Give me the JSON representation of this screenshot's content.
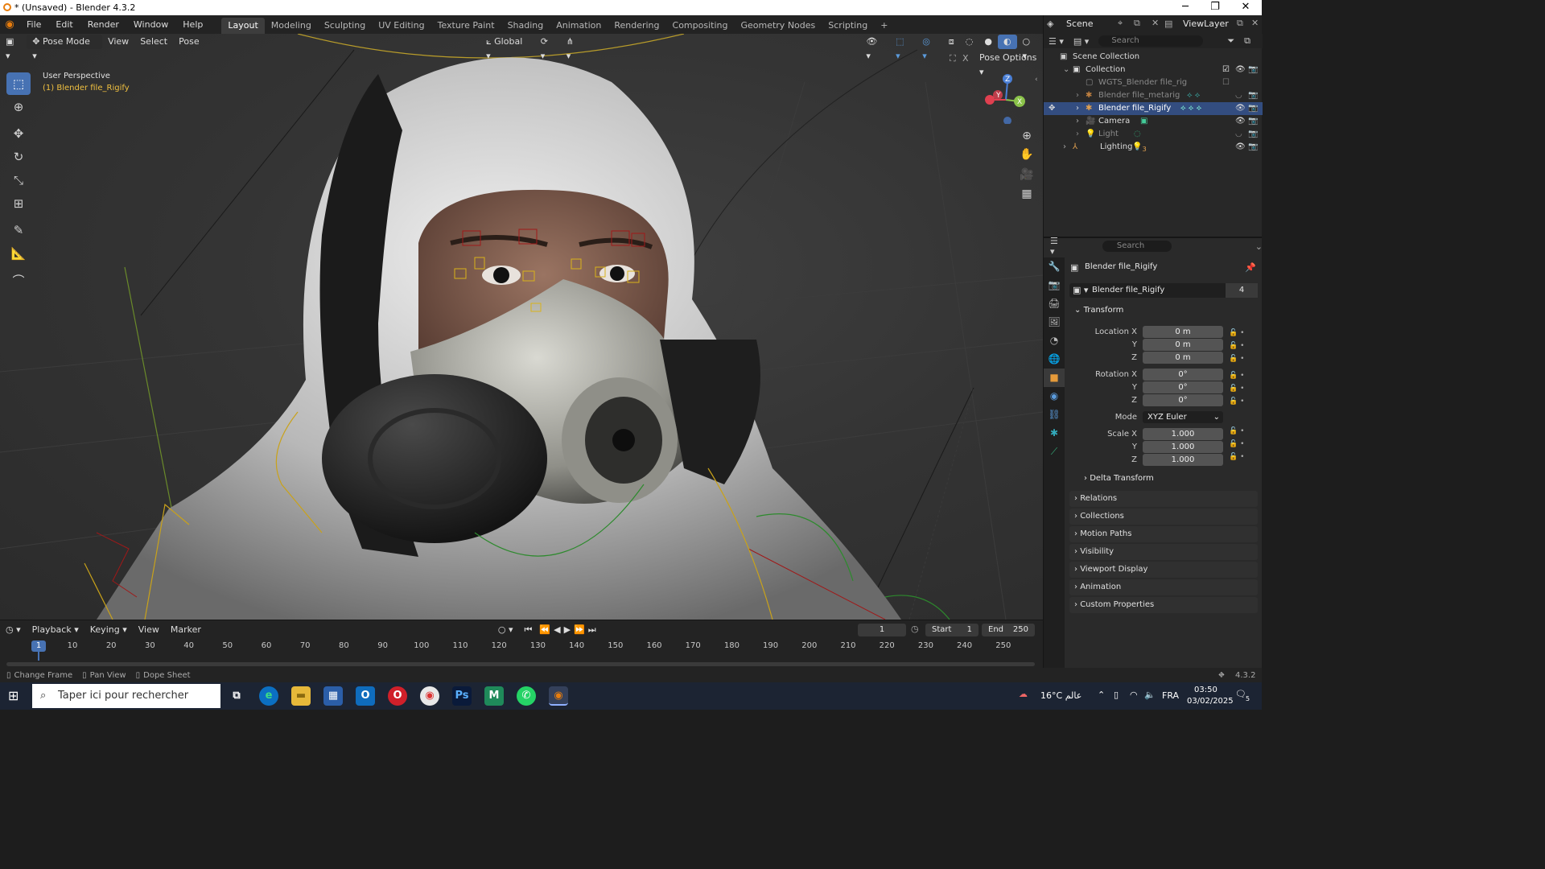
{
  "window": {
    "title": "* (Unsaved) - Blender 4.3.2",
    "controls": [
      "─",
      "❐",
      "✕"
    ]
  },
  "topmenu": {
    "menus": [
      "File",
      "Edit",
      "Render",
      "Window",
      "Help"
    ],
    "workspaces": [
      "Layout",
      "Modeling",
      "Sculpting",
      "UV Editing",
      "Texture Paint",
      "Shading",
      "Animation",
      "Rendering",
      "Compositing",
      "Geometry Nodes",
      "Scripting"
    ],
    "active_workspace": "Layout",
    "add_tab": "+"
  },
  "scenebar": {
    "scene": "Scene",
    "view_layer": "ViewLayer"
  },
  "viewport": {
    "mode": "Pose Mode",
    "menus": [
      "View",
      "Select",
      "Pose"
    ],
    "orientation": "Global",
    "options": "Pose Options",
    "perspective_label": "User Perspective",
    "object_label": "(1) Blender file_Rigify",
    "gizmo": {
      "x": "X",
      "y": "Y",
      "z": "Z"
    }
  },
  "outliner": {
    "search_placeholder": "Search",
    "scene_collection": "Scene Collection",
    "items": [
      {
        "label": "Collection"
      },
      {
        "label": "WGTS_Blender file_rig"
      },
      {
        "label": "Blender file_metarig"
      },
      {
        "label": "Blender file_Rigify"
      },
      {
        "label": "Camera"
      },
      {
        "label": "Light"
      },
      {
        "label": "Lighting",
        "count": "3"
      }
    ]
  },
  "properties": {
    "search_placeholder": "Search",
    "object_name": "Blender file_Rigify",
    "datablock_name": "Blender file_Rigify",
    "user_count": "4",
    "transform_header": "Transform",
    "location": {
      "label_x": "Location X",
      "label_y": "Y",
      "label_z": "Z",
      "x": "0 m",
      "y": "0 m",
      "z": "0 m"
    },
    "rotation": {
      "label_x": "Rotation X",
      "label_y": "Y",
      "label_z": "Z",
      "x": "0°",
      "y": "0°",
      "z": "0°"
    },
    "mode_label": "Mode",
    "mode_value": "XYZ Euler",
    "scale": {
      "label_x": "Scale X",
      "label_y": "Y",
      "label_z": "Z",
      "x": "1.000",
      "y": "1.000",
      "z": "1.000"
    },
    "delta_transform": "Delta Transform",
    "panels": [
      "Relations",
      "Collections",
      "Motion Paths",
      "Visibility",
      "Viewport Display",
      "Animation",
      "Custom Properties"
    ]
  },
  "timeline": {
    "menus": [
      "Playback",
      "Keying",
      "View",
      "Marker"
    ],
    "current_frame": "1",
    "start_label": "Start",
    "start": "1",
    "end_label": "End",
    "end": "250",
    "ticks": [
      "10",
      "20",
      "30",
      "40",
      "50",
      "60",
      "70",
      "80",
      "90",
      "100",
      "110",
      "120",
      "130",
      "140",
      "150",
      "160",
      "170",
      "180",
      "190",
      "200",
      "210",
      "220",
      "230",
      "240",
      "250"
    ],
    "cursor_frame": "1"
  },
  "statusbar": {
    "hints": [
      "Change Frame",
      "Pan View",
      "Dope Sheet"
    ],
    "version": "4.3.2"
  },
  "taskbar": {
    "search_placeholder": "Taper ici pour rechercher",
    "weather": "16°C  عالم",
    "language": "FRA",
    "time": "03:50",
    "date": "03/02/2025",
    "notification_count": "5"
  }
}
